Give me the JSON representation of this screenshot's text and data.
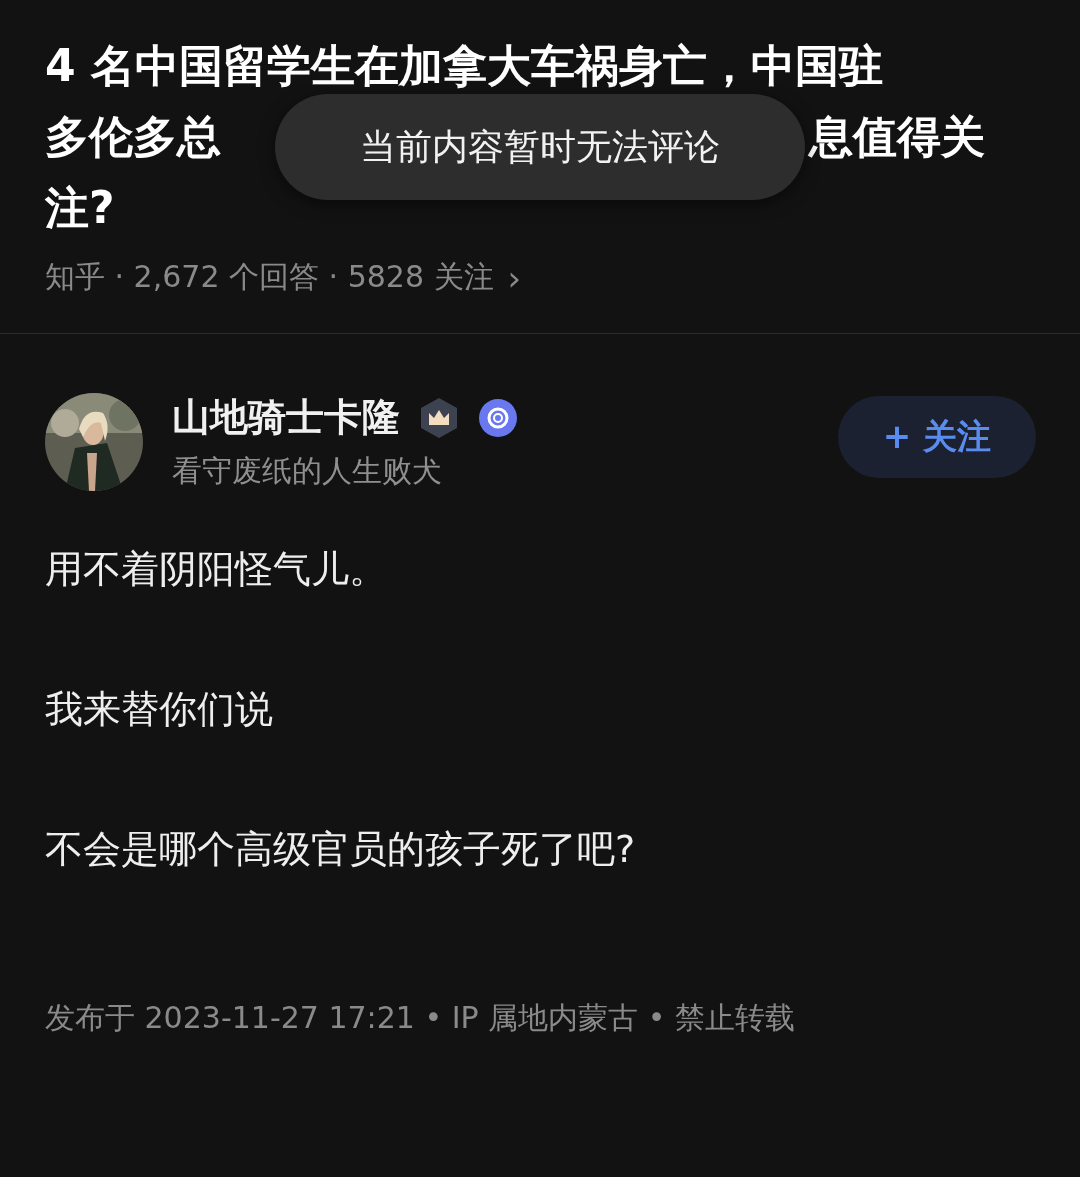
{
  "question": {
    "title_lines": [
      [
        "4 名中国留学生在加拿大车祸身亡，中国驻"
      ],
      [
        "多伦多总",
        "息值得关"
      ],
      [
        "注?"
      ]
    ],
    "meta": "知乎 · 2,672 个回答 · 5828 关注",
    "meta_chevron": "›"
  },
  "toast": {
    "text": "当前内容暂时无法评论"
  },
  "author": {
    "name": "山地骑士卡隆",
    "bio": "看守废纸的人生败犬",
    "follow_button": "+ 关注",
    "following": false
  },
  "answer": {
    "paragraphs": [
      "用不着阴阳怪气儿。",
      "我来替你们说",
      "不会是哪个高级官员的孩子死了吧?"
    ],
    "footer": "发布于 2023-11-27 17:21 • IP 属地内蒙古 • 禁止转载"
  }
}
